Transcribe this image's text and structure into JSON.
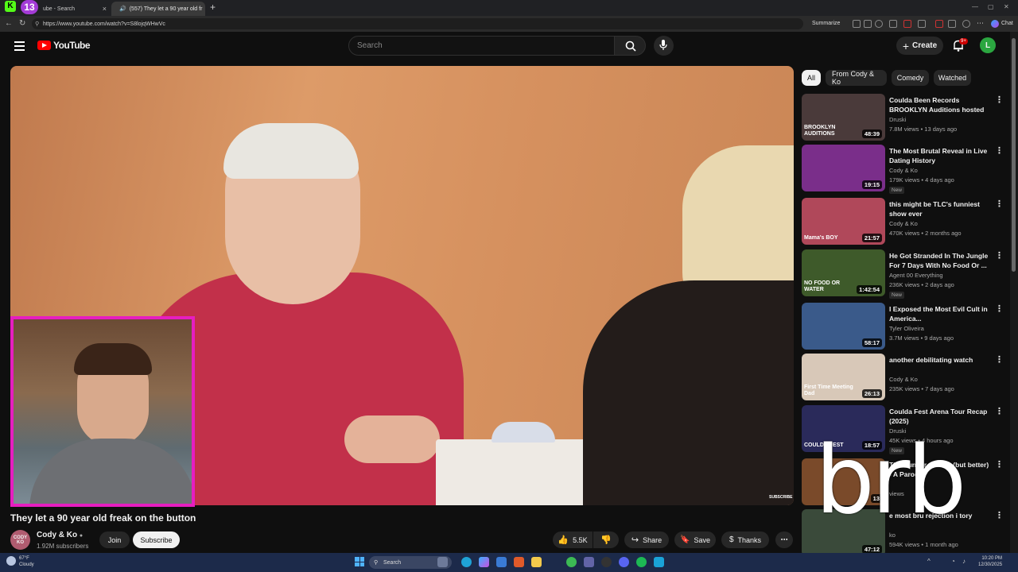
{
  "browser": {
    "tabs": [
      {
        "label": "ube - Search"
      },
      {
        "label": "(557) They let a 90 year old fr"
      }
    ],
    "kick_badge": "13",
    "url": "https://www.youtube.com/watch?v=S8lojqWHwVc",
    "summarize_label": "Summarize",
    "chat_label": "Chat"
  },
  "yt": {
    "logo_text": "YouTube",
    "search_placeholder": "Search",
    "create_label": "Create",
    "notif_count": "9+",
    "avatar_letter": "L"
  },
  "video": {
    "title": "They let a 90 year old freak on the button",
    "channel": "Cody & Ko",
    "subscribers": "1.92M subscribers",
    "join_label": "Join",
    "subscribe_label": "Subscribe",
    "like_count": "5.5K",
    "share_label": "Share",
    "save_label": "Save",
    "thanks_label": "Thanks",
    "watermark": "SUBSCRIBE",
    "avatar_text": "CODY KO"
  },
  "chips": [
    "All",
    "From Cody & Ko",
    "Comedy",
    "Watched"
  ],
  "recommendations": [
    {
      "title": "Coulda Been Records BROOKLYN Auditions hosted b...",
      "channel": "Druski",
      "meta": "7.8M views • 13 days ago",
      "duration": "48:39",
      "new": "",
      "thumb_color": "#4a3a3a",
      "thumb_text": "BROOKLYN AUDITIONS"
    },
    {
      "title": "The Most Brutal Reveal in Live Dating History",
      "channel": "Cody & Ko",
      "meta": "179K views • 4 days ago",
      "duration": "19:15",
      "new": "New",
      "thumb_color": "#7a2e8a",
      "thumb_text": ""
    },
    {
      "title": "this might be TLC's funniest show ever",
      "channel": "Cody & Ko",
      "meta": "470K views • 2 months ago",
      "duration": "21:57",
      "new": "",
      "thumb_color": "#b0485a",
      "thumb_text": "Mama's BOY"
    },
    {
      "title": "He Got Stranded In The Jungle For 7 Days With No Food Or ...",
      "channel": "Agent 00 Everything",
      "meta": "236K views • 2 days ago",
      "duration": "1:42:54",
      "new": "New",
      "thumb_color": "#3e5a2a",
      "thumb_text": "NO FOOD OR WATER"
    },
    {
      "title": "I Exposed the Most Evil Cult in America...",
      "channel": "Tyler Oliveira",
      "meta": "3.7M views • 9 days ago",
      "duration": "58:17",
      "new": "",
      "thumb_color": "#3a5a8a",
      "thumb_text": ""
    },
    {
      "title": "another debilitating watch",
      "channel": "Cody & Ko",
      "meta": "235K views • 7 days ago",
      "duration": "26:13",
      "new": "",
      "thumb_color": "#d8c8b8",
      "thumb_text": "First Time Meeting Dad"
    },
    {
      "title": "Coulda Fest Arena Tour Recap (2025)",
      "channel": "Druski",
      "meta": "45K views • 4 hours ago",
      "duration": "18:57",
      "new": "New",
      "thumb_color": "#2a2a5a",
      "thumb_text": "COULDA FEST"
    },
    {
      "title": "The Hunger Games (but better) - A Parody",
      "channel": "",
      "meta": "views",
      "duration": "13",
      "new": "",
      "thumb_color": "#7a4a2a",
      "thumb_text": ""
    },
    {
      "title": "e most bru rejection i tory",
      "channel": "ko",
      "meta": "594K views • 1 month ago",
      "duration": "47:12",
      "new": "",
      "thumb_color": "#3a4a3a",
      "thumb_text": ""
    }
  ],
  "overlay": {
    "text": "brb"
  },
  "taskbar": {
    "search_label": "Search",
    "weather_temp": "67°F",
    "weather_desc": "Cloudy",
    "time": "10:20 PM",
    "date": "12/30/2025"
  },
  "colors": {
    "accent_red": "#ff0000",
    "webcam_border": "#e61ec0",
    "kick_green": "#53fc18"
  }
}
